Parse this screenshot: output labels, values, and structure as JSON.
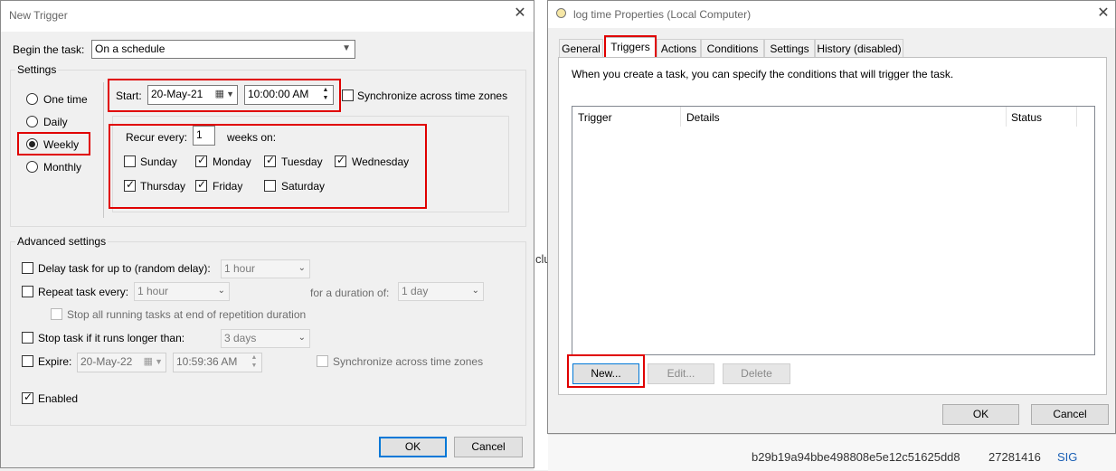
{
  "background": {
    "hash_text": "b29b19a94bbe498808e5e12c51625dd8",
    "number_text": "27281416",
    "sig_text": "SIG",
    "partial_text": "clu"
  },
  "new_trigger": {
    "title": "New Trigger",
    "begin_label": "Begin the task:",
    "begin_value": "On a schedule",
    "settings_label": "Settings",
    "schedule_options": [
      "One time",
      "Daily",
      "Weekly",
      "Monthly"
    ],
    "selected_schedule": "Weekly",
    "start_label": "Start:",
    "start_date": "20-May-21",
    "start_time": "10:00:00 AM",
    "sync_label": "Synchronize across time zones",
    "recur_label": "Recur every:",
    "recur_value": "1",
    "weeks_on_label": "weeks on:",
    "days": {
      "sunday": "Sunday",
      "monday": "Monday",
      "tuesday": "Tuesday",
      "wednesday": "Wednesday",
      "thursday": "Thursday",
      "friday": "Friday",
      "saturday": "Saturday"
    },
    "advanced_label": "Advanced settings",
    "delay_label": "Delay task for up to (random delay):",
    "delay_value": "1 hour",
    "repeat_label": "Repeat task every:",
    "repeat_value": "1 hour",
    "duration_label": "for a duration of:",
    "duration_value": "1 day",
    "stop_running_label": "Stop all running tasks at end of repetition duration",
    "stop_longer_label": "Stop task if it runs longer than:",
    "stop_longer_value": "3 days",
    "expire_label": "Expire:",
    "expire_date": "20-May-22",
    "expire_time": "10:59:36 AM",
    "expire_sync_label": "Synchronize across time zones",
    "enabled_label": "Enabled",
    "ok_label": "OK",
    "cancel_label": "Cancel"
  },
  "properties": {
    "title": "log time Properties (Local Computer)",
    "tabs": [
      "General",
      "Triggers",
      "Actions",
      "Conditions",
      "Settings",
      "History (disabled)"
    ],
    "active_tab": "Triggers",
    "description": "When you create a task, you can specify the conditions that will trigger the task.",
    "columns": [
      "Trigger",
      "Details",
      "Status"
    ],
    "new_label": "New...",
    "edit_label": "Edit...",
    "delete_label": "Delete",
    "ok_label": "OK",
    "cancel_label": "Cancel"
  },
  "colors": {
    "highlight": "#e00000",
    "default_button_border": "#0078d7",
    "sig_link": "#1a5fb4"
  }
}
